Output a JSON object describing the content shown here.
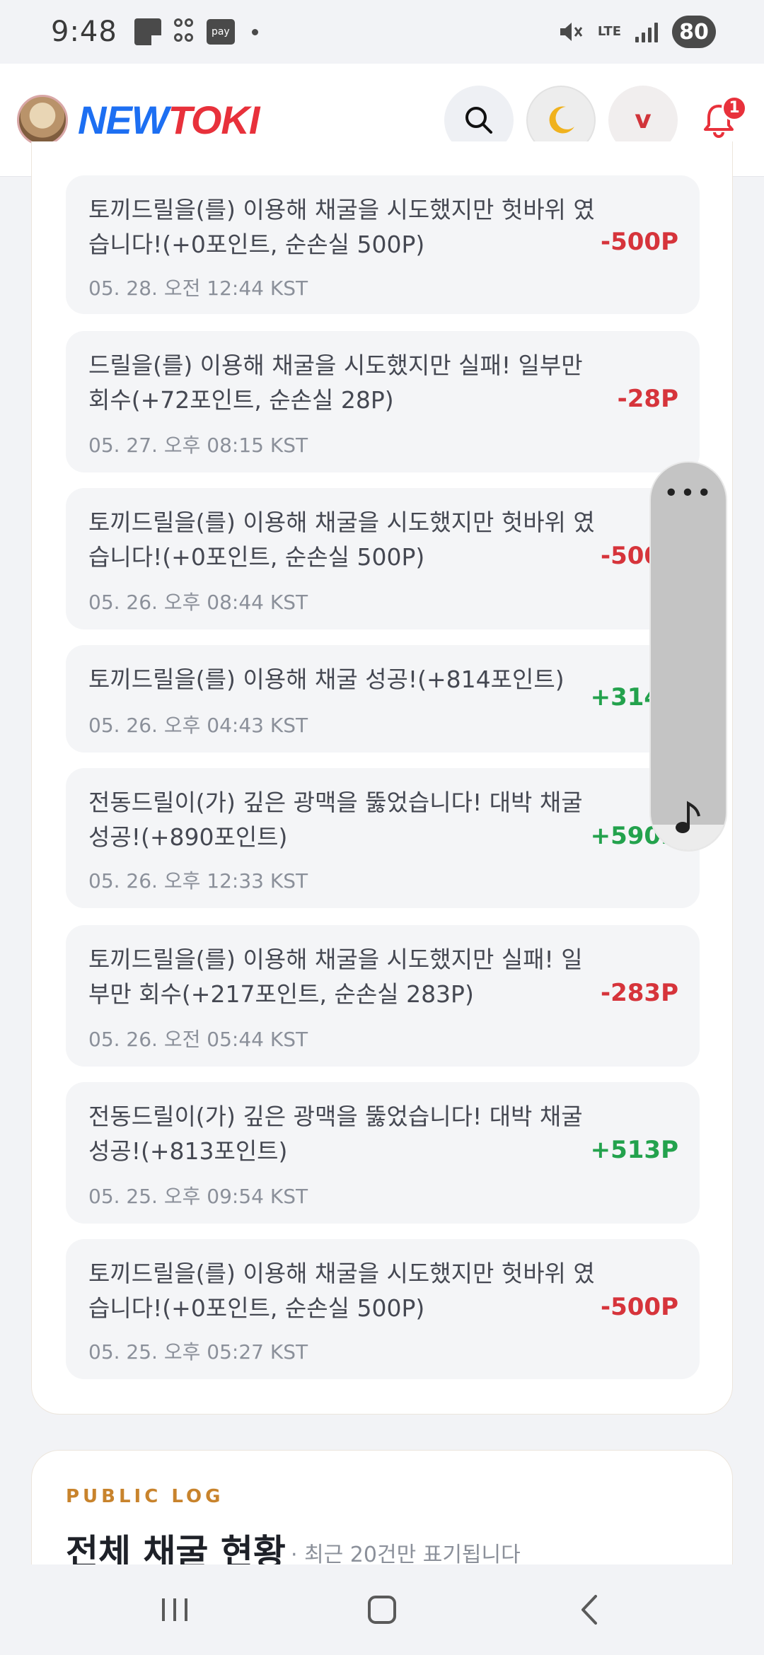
{
  "status_bar": {
    "time": "9:48",
    "pay_label": "pay",
    "network": "LTE",
    "battery": "80"
  },
  "header": {
    "logo_new": "NEW",
    "logo_toki": "TOKI",
    "user_initial": "v",
    "notification_count": "1",
    "icons": [
      "search-icon",
      "moon-icon",
      "bell-icon"
    ]
  },
  "mining_log": [
    {
      "text": "토끼드릴을(를) 이용해 채굴을 시도했지만 헛바위 였습니다!(+0포인트, 순손실 500P)",
      "date": "05. 28. 오전 12:44 KST",
      "amount": "-500P",
      "type": "neg"
    },
    {
      "text": "드릴을(를) 이용해 채굴을 시도했지만 실패! 일부만 회수(+72포인트, 순손실 28P)",
      "date": "05. 27. 오후 08:15 KST",
      "amount": "-28P",
      "type": "neg"
    },
    {
      "text": "토끼드릴을(를) 이용해 채굴을 시도했지만 헛바위 였습니다!(+0포인트, 순손실 500P)",
      "date": "05. 26. 오후 08:44 KST",
      "amount": "-500P",
      "type": "neg"
    },
    {
      "text": "토끼드릴을(를) 이용해 채굴 성공!(+814포인트)",
      "date": "05. 26. 오후 04:43 KST",
      "amount": "+314P",
      "type": "pos"
    },
    {
      "text": "전동드릴이(가) 깊은 광맥을 뚫었습니다! 대박 채굴 성공!(+890포인트)",
      "date": "05. 26. 오후 12:33 KST",
      "amount": "+590P",
      "type": "pos"
    },
    {
      "text": "토끼드릴을(를) 이용해 채굴을 시도했지만 실패! 일부만 회수(+217포인트, 순손실 283P)",
      "date": "05. 26. 오전 05:44 KST",
      "amount": "-283P",
      "type": "neg"
    },
    {
      "text": "전동드릴이(가) 깊은 광맥을 뚫었습니다! 대박 채굴 성공!(+813포인트)",
      "date": "05. 25. 오후 09:54 KST",
      "amount": "+513P",
      "type": "pos"
    },
    {
      "text": "토끼드릴을(를) 이용해 채굴을 시도했지만 헛바위 였습니다!(+0포인트, 순손실 500P)",
      "date": "05. 25. 오후 05:27 KST",
      "amount": "-500P",
      "type": "neg"
    }
  ],
  "floating_widget": {
    "menu_icon": "more-dots-icon",
    "note_icon": "music-note-icon"
  },
  "public_log": {
    "label": "PUBLIC LOG",
    "title": "전체 채굴 현황",
    "note": "· 최근 20건만 표기됩니다"
  },
  "colors": {
    "negative": "#d6343b",
    "positive": "#23a24d",
    "accent": "#c8832c",
    "brand_blue": "#1d6ff2",
    "brand_red": "#e8313b"
  }
}
